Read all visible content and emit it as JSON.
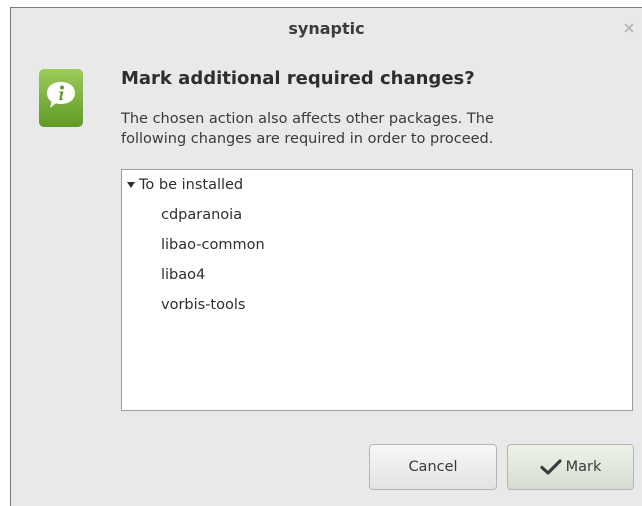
{
  "window": {
    "title": "synaptic",
    "close_glyph": "×"
  },
  "dialog": {
    "icon": "info-icon",
    "heading": "Mark additional required changes?",
    "message_lines": [
      "The chosen action also affects other packages. The",
      "following changes are required in order to proceed."
    ]
  },
  "changes": {
    "group_label": "To be installed",
    "expanded": true,
    "packages": [
      "cdparanoia",
      "libao-common",
      "libao4",
      "vorbis-tools"
    ]
  },
  "buttons": {
    "cancel_label": "Cancel",
    "mark_label": "Mark",
    "mark_icon": "checkmark-icon"
  },
  "colors": {
    "dialog_bg": "#e9e9e9",
    "icon_green": "#7bb33a"
  }
}
